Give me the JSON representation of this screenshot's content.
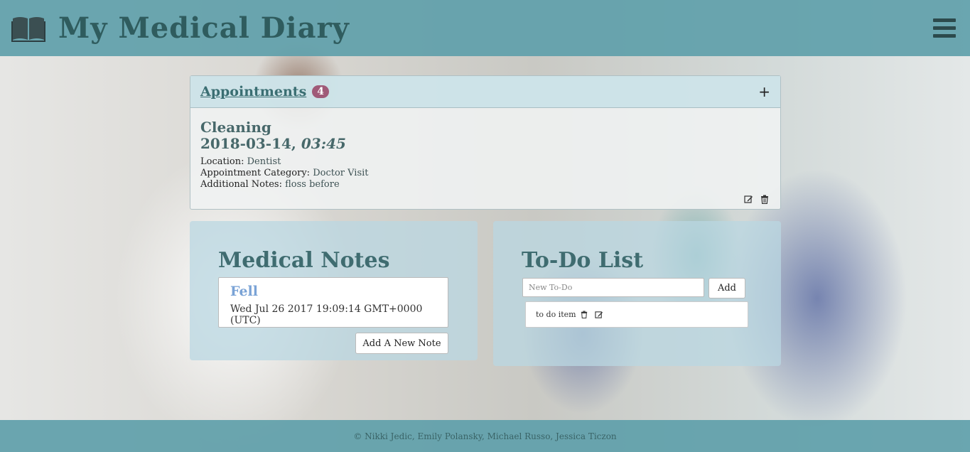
{
  "navbar": {
    "title": "My Medical Diary",
    "brand_icon": "book-open-icon",
    "menu_icon": "hamburger-menu-icon"
  },
  "appointments": {
    "heading": "Appointments",
    "count": "4",
    "toggle_icon": "+",
    "items": [
      {
        "title": "Cleaning",
        "date": "2018-03-14,",
        "time": "03:45",
        "location_label": "Location:",
        "location": "Dentist",
        "category_label": "Appointment Category:",
        "category": "Doctor Visit",
        "notes_label": "Additional Notes:",
        "notes": "floss before",
        "edit_icon": "edit-icon",
        "delete_icon": "trash-icon"
      }
    ]
  },
  "medical_notes": {
    "heading": "Medical Notes",
    "notes": [
      {
        "title": "Fell",
        "timestamp": "Wed Jul 26 2017 19:09:14 GMT+0000 (UTC)"
      }
    ],
    "add_button": "Add A New Note"
  },
  "todo": {
    "heading": "To-Do List",
    "input_placeholder": "New To-Do",
    "add_button": "Add",
    "items": [
      {
        "text": "to do item"
      }
    ]
  },
  "footer": {
    "text": "© Nikki Jedic, Emily Polansky, Michael Russo, Jessica Ticzon"
  },
  "colors": {
    "navbar": "#5fa0aa",
    "badge": "#a05a78",
    "heading_text": "#3f6c70",
    "note_title": "#7aa3d6"
  }
}
